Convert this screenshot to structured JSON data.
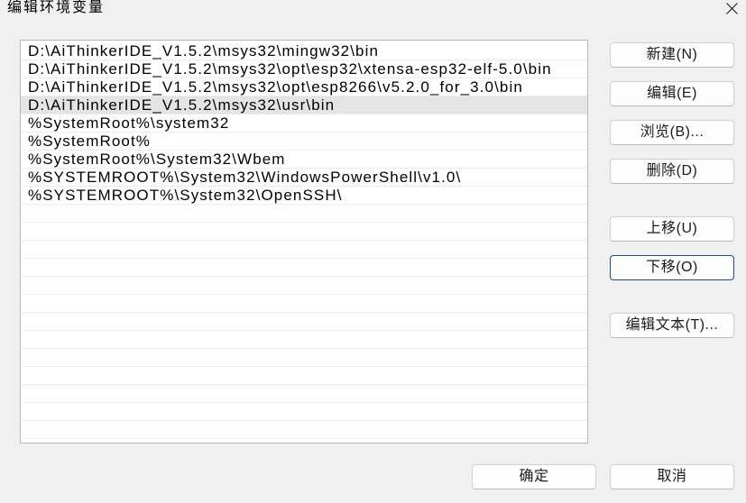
{
  "window": {
    "title": "编辑环境变量",
    "close_icon": "close-icon"
  },
  "path_list": {
    "items": [
      "D:\\AiThinkerIDE_V1.5.2\\msys32\\mingw32\\bin",
      "D:\\AiThinkerIDE_V1.5.2\\msys32\\opt\\esp32\\xtensa-esp32-elf-5.0\\bin",
      "D:\\AiThinkerIDE_V1.5.2\\msys32\\opt\\esp8266\\v5.2.0_for_3.0\\bin",
      "D:\\AiThinkerIDE_V1.5.2\\msys32\\usr\\bin",
      "%SystemRoot%\\system32",
      "%SystemRoot%",
      "%SystemRoot%\\System32\\Wbem",
      "%SYSTEMROOT%\\System32\\WindowsPowerShell\\v1.0\\",
      "%SYSTEMROOT%\\System32\\OpenSSH\\"
    ],
    "selected_index": 3
  },
  "buttons": {
    "new": "新建(N)",
    "edit": "编辑(E)",
    "browse": "浏览(B)...",
    "delete": "删除(D)",
    "move_up": "上移(U)",
    "move_down": "下移(O)",
    "edit_text": "编辑文本(T)...",
    "ok": "确定",
    "cancel": "取消"
  }
}
